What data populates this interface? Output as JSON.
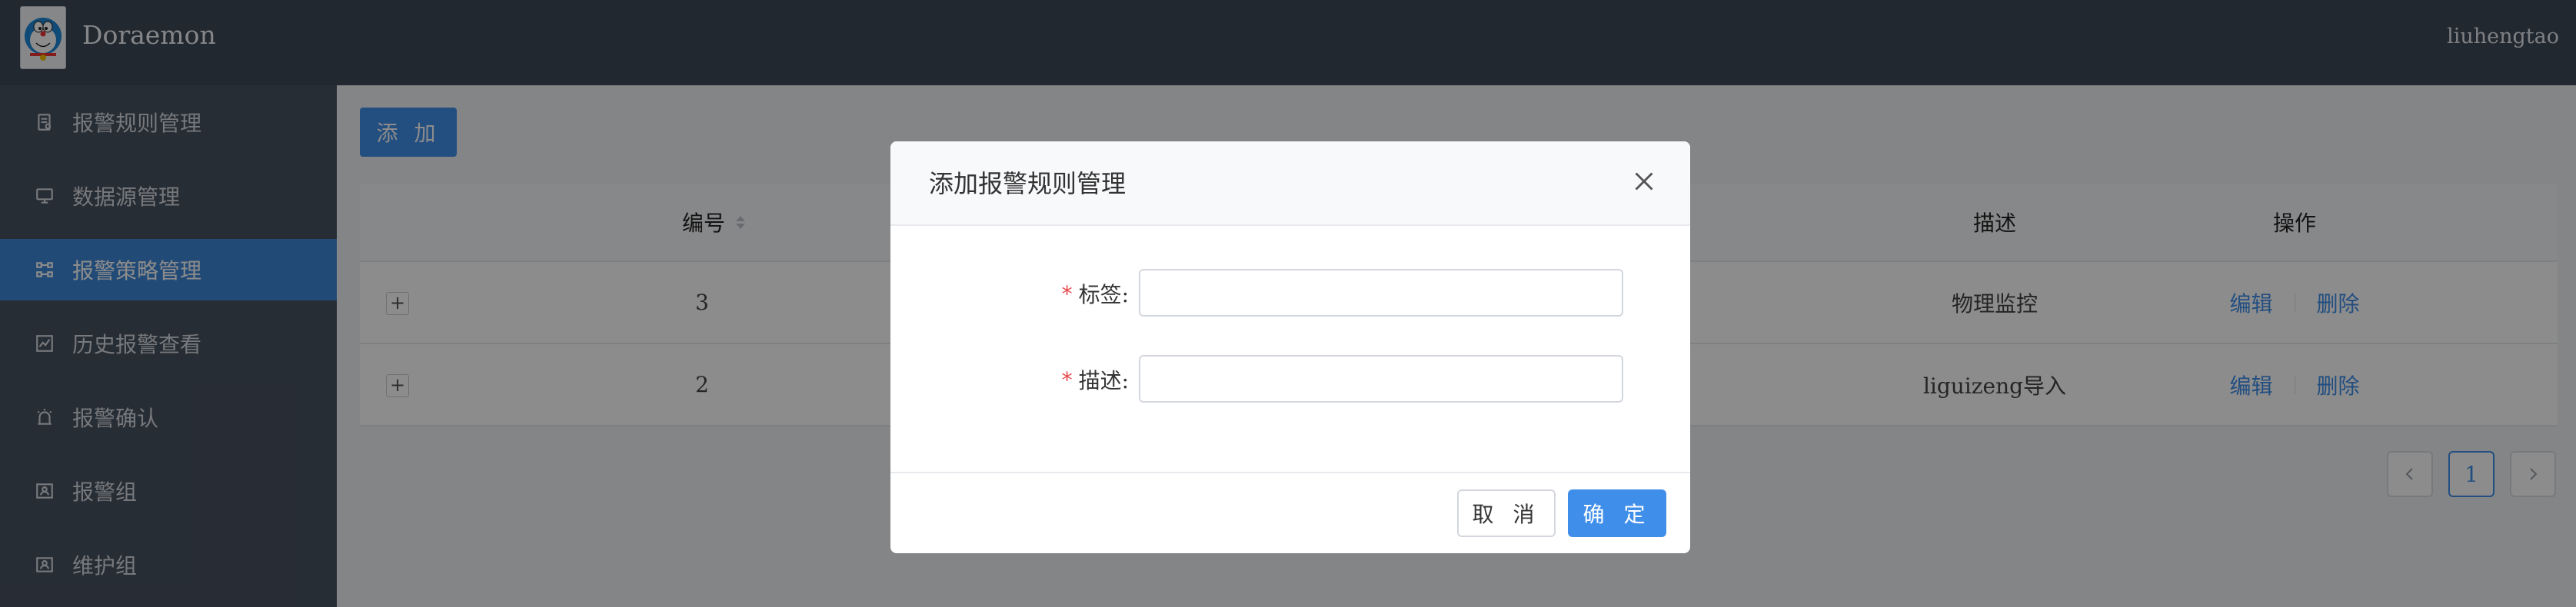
{
  "header": {
    "app_title": "Doraemon",
    "username": "liuhengtao"
  },
  "sidebar": {
    "items": [
      {
        "label": "报警规则管理",
        "icon": "document-icon",
        "active": false
      },
      {
        "label": "数据源管理",
        "icon": "monitor-icon",
        "active": false
      },
      {
        "label": "报警策略管理",
        "icon": "node-graph-icon",
        "active": true
      },
      {
        "label": "历史报警查看",
        "icon": "line-chart-icon",
        "active": false
      },
      {
        "label": "报警确认",
        "icon": "alarm-light-icon",
        "active": false
      },
      {
        "label": "报警组",
        "icon": "contacts-icon",
        "active": false
      },
      {
        "label": "维护组",
        "icon": "contacts-icon",
        "active": false
      }
    ]
  },
  "toolbar": {
    "add_label": "添 加"
  },
  "table": {
    "columns": [
      "编号",
      "描述",
      "操作"
    ],
    "rows": [
      {
        "id": "3",
        "description": "物理监控",
        "edit": "编辑",
        "delete": "删除"
      },
      {
        "id": "2",
        "description": "liguizeng导入",
        "edit": "编辑",
        "delete": "删除"
      }
    ],
    "expand_glyph": "+"
  },
  "pagination": {
    "current_page": "1"
  },
  "modal": {
    "title": "添加报警规则管理",
    "fields": [
      {
        "label": "标签:",
        "required_mark": "*",
        "value": ""
      },
      {
        "label": "描述:",
        "required_mark": "*",
        "value": ""
      }
    ],
    "cancel_label": "取 消",
    "ok_label": "确 定"
  },
  "colors": {
    "header_bg": "#3f4a58",
    "sidebar_bg": "#485260",
    "accent": "#3f8ee9",
    "required": "#e5484d"
  }
}
